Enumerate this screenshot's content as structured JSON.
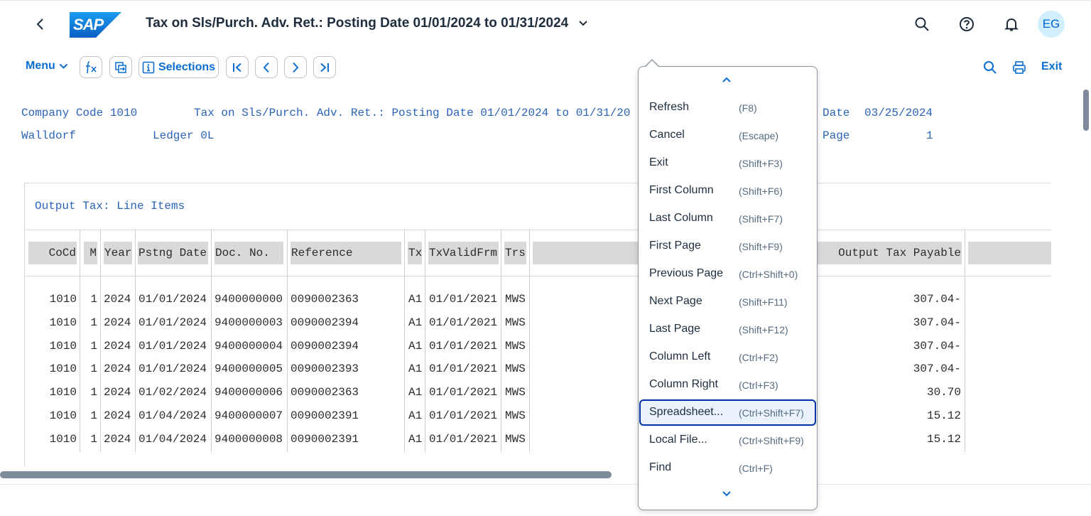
{
  "shell": {
    "logo_text": "SAP",
    "title": "Tax on Sls/Purch. Adv. Ret.: Posting Date 01/01/2024 to 01/31/2024",
    "avatar_initials": "EG"
  },
  "toolbar": {
    "menu_label": "Menu",
    "selections_label": "Selections",
    "exit_label": "Exit"
  },
  "report_header": {
    "company_code": "Company Code 1010",
    "report_title": "Tax on Sls/Purch. Adv. Ret.: Posting Date 01/01/2024 to 01/31/20",
    "city": "Walldorf",
    "ledger": "Ledger 0L",
    "date_label": "Date",
    "date_value": "03/25/2024",
    "page_label": "Page",
    "page_value": "1"
  },
  "section_title": "Output Tax: Line Items",
  "table": {
    "columns": [
      "CoCd",
      "M",
      "Year",
      "Pstng Date",
      "Doc. No.",
      "Reference",
      "Tx",
      "TxValidFrm",
      "Trs",
      "",
      "Output Tax Payable",
      ""
    ],
    "rows": [
      {
        "cocd": "1010",
        "m": "1",
        "year": "2024",
        "date": "01/01/2024",
        "doc": "9400000000",
        "ref": "0090002363",
        "tx": "A1",
        "valid": "01/01/2021",
        "trs": "MWS",
        "amount": "307.04-"
      },
      {
        "cocd": "1010",
        "m": "1",
        "year": "2024",
        "date": "01/01/2024",
        "doc": "9400000003",
        "ref": "0090002394",
        "tx": "A1",
        "valid": "01/01/2021",
        "trs": "MWS",
        "amount": "307.04-"
      },
      {
        "cocd": "1010",
        "m": "1",
        "year": "2024",
        "date": "01/01/2024",
        "doc": "9400000004",
        "ref": "0090002394",
        "tx": "A1",
        "valid": "01/01/2021",
        "trs": "MWS",
        "amount": "307.04-"
      },
      {
        "cocd": "1010",
        "m": "1",
        "year": "2024",
        "date": "01/01/2024",
        "doc": "9400000005",
        "ref": "0090002393",
        "tx": "A1",
        "valid": "01/01/2021",
        "trs": "MWS",
        "amount": "307.04-"
      },
      {
        "cocd": "1010",
        "m": "1",
        "year": "2024",
        "date": "01/02/2024",
        "doc": "9400000006",
        "ref": "0090002363",
        "tx": "A1",
        "valid": "01/01/2021",
        "trs": "MWS",
        "amount": "30.70"
      },
      {
        "cocd": "1010",
        "m": "1",
        "year": "2024",
        "date": "01/04/2024",
        "doc": "9400000007",
        "ref": "0090002391",
        "tx": "A1",
        "valid": "01/01/2021",
        "trs": "MWS",
        "amount": "15.12"
      },
      {
        "cocd": "1010",
        "m": "1",
        "year": "2024",
        "date": "01/04/2024",
        "doc": "9400000008",
        "ref": "0090002391",
        "tx": "A1",
        "valid": "01/01/2021",
        "trs": "MWS",
        "amount": "15.12"
      }
    ]
  },
  "dropdown": {
    "items": [
      {
        "label": "Refresh",
        "shortcut": "(F8)"
      },
      {
        "label": "Cancel",
        "shortcut": "(Escape)"
      },
      {
        "label": "Exit",
        "shortcut": "(Shift+F3)"
      },
      {
        "label": "First Column",
        "shortcut": "(Shift+F6)"
      },
      {
        "label": "Last Column",
        "shortcut": "(Shift+F7)"
      },
      {
        "label": "First Page",
        "shortcut": "(Shift+F9)"
      },
      {
        "label": "Previous Page",
        "shortcut": "(Ctrl+Shift+0)"
      },
      {
        "label": "Next Page",
        "shortcut": "(Shift+F11)"
      },
      {
        "label": "Last Page",
        "shortcut": "(Shift+F12)"
      },
      {
        "label": "Column Left",
        "shortcut": "(Ctrl+F2)"
      },
      {
        "label": "Column Right",
        "shortcut": "(Ctrl+F3)"
      },
      {
        "label": "Spreadsheet...",
        "shortcut": "(Ctrl+Shift+F7)",
        "selected": true
      },
      {
        "label": "Local File...",
        "shortcut": "(Ctrl+Shift+F9)"
      },
      {
        "label": "Find",
        "shortcut": "(Ctrl+F)"
      }
    ]
  },
  "colors": {
    "accent": "#0a6ed1",
    "report_text": "#2a63b8",
    "header_bg": "#d9d9d9",
    "avatar_bg": "#d1efff",
    "selected_border": "#0032a5"
  }
}
